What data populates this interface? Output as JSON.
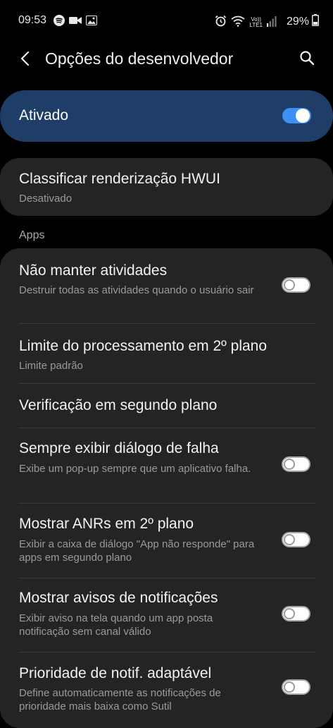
{
  "status_bar": {
    "time": "09:53",
    "battery": "29%",
    "left_icons": [
      "spotify-icon",
      "video-camera-icon",
      "gallery-icon"
    ],
    "right_icons": [
      "alarm-icon",
      "wifi-icon",
      "volte-lte-icon",
      "signal-icon",
      "battery-icon"
    ],
    "volte_top": "Vo))",
    "volte_bottom": "LTE1"
  },
  "header": {
    "title": "Opções do desenvolvedor"
  },
  "master": {
    "label": "Ativado",
    "state": "on",
    "accent": "#3e8ff6",
    "card_color": "#1f3e67"
  },
  "hwui": {
    "title": "Classificar renderização HWUI",
    "subtitle": "Desativado"
  },
  "section_apps": "Apps",
  "apps_items": [
    {
      "title": "Não manter atividades",
      "subtitle": "Destruir todas as atividades quando o usuário sair",
      "toggle": "off"
    },
    {
      "title": "Limite do processamento em 2º plano",
      "subtitle": "Limite padrão"
    },
    {
      "title": "Verificação em segundo plano"
    },
    {
      "title": "Sempre exibir diálogo de falha",
      "subtitle": "Exibe um pop-up sempre que um aplicativo falha.",
      "toggle": "off"
    },
    {
      "title": "Mostrar ANRs em 2º plano",
      "subtitle": "Exibir a caixa de diálogo \"App não responde\" para apps em segundo plano",
      "toggle": "off"
    },
    {
      "title": "Mostrar avisos de notificações",
      "subtitle": "Exibir aviso na tela quando um app posta notificação sem canal válido",
      "toggle": "off"
    },
    {
      "title": "Prioridade de notif. adaptável",
      "subtitle": "Define automaticamente as notificações de prioridade mais baixa como Sutil",
      "toggle": "off"
    }
  ]
}
